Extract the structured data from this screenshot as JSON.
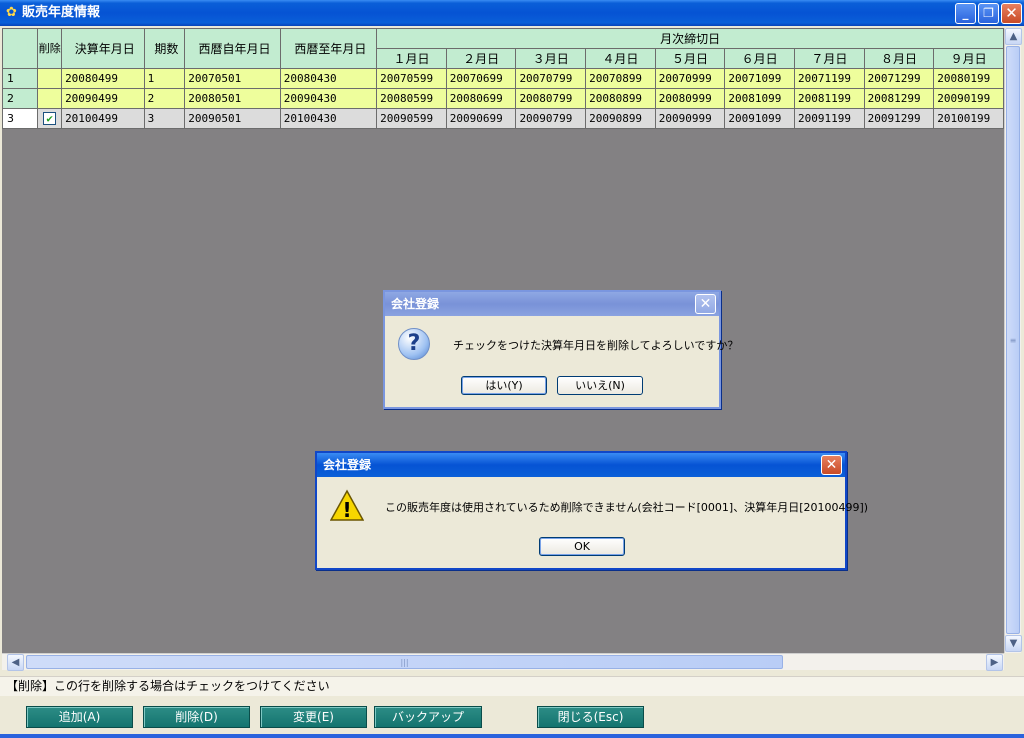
{
  "window": {
    "title": "販売年度情報",
    "minimize": "_",
    "restore": "❐",
    "close": "✕"
  },
  "grid": {
    "headers": {
      "delete": "削除",
      "fiscal_date": "決算年月日",
      "period": "期数",
      "start_date": "西暦自年月日",
      "end_date": "西暦至年月日",
      "monthly_close": "月次締切日",
      "months": [
        "１月日",
        "２月日",
        "３月日",
        "４月日",
        "５月日",
        "６月日",
        "７月日",
        "８月日",
        "９月日"
      ]
    },
    "rows": [
      {
        "num": "1",
        "checked": "",
        "fiscal": "20080499",
        "period": "1",
        "start": "20070501",
        "end": "20080430",
        "months": [
          "20070599",
          "20070699",
          "20070799",
          "20070899",
          "20070999",
          "20071099",
          "20071199",
          "20071299",
          "20080199"
        ]
      },
      {
        "num": "2",
        "checked": "",
        "fiscal": "20090499",
        "period": "2",
        "start": "20080501",
        "end": "20090430",
        "months": [
          "20080599",
          "20080699",
          "20080799",
          "20080899",
          "20080999",
          "20081099",
          "20081199",
          "20081299",
          "20090199"
        ]
      },
      {
        "num": "3",
        "checked": "✔",
        "fiscal": "20100499",
        "period": "3",
        "start": "20090501",
        "end": "20100430",
        "months": [
          "20090599",
          "20090699",
          "20090799",
          "20090899",
          "20090999",
          "20091099",
          "20091199",
          "20091299",
          "20100199"
        ]
      }
    ]
  },
  "scroll": {
    "up": "▲",
    "down": "▼",
    "left": "◀",
    "right": "▶",
    "grip_v": "≡",
    "grip_h": "|||"
  },
  "status": {
    "message": "【削除】この行を削除する場合はチェックをつけてください"
  },
  "buttons": {
    "add": "追加(A)",
    "delete": "削除(D)",
    "change": "変更(E)",
    "backup": "バックアップ",
    "close": "閉じる(Esc)"
  },
  "dialog_confirm": {
    "title": "会社登録",
    "close": "✕",
    "icon": "?",
    "message": "チェックをつけた決算年月日を削除してよろしいですか？",
    "yes": "はい(Y)",
    "no": "いいえ(N)"
  },
  "dialog_error": {
    "title": "会社登録",
    "close": "✕",
    "icon": "!",
    "message": "この販売年度は使用されているため削除できません(会社コード[0001]、決算年月日[20100499])",
    "ok": "OK"
  },
  "colors": {
    "titlebar": "#0653d4",
    "header_bg": "#c2ecd0",
    "row_highlight": "#eefe9c",
    "row_selected": "#dcdcdc",
    "grid_bg": "#838183",
    "action_button": "#14746f"
  }
}
